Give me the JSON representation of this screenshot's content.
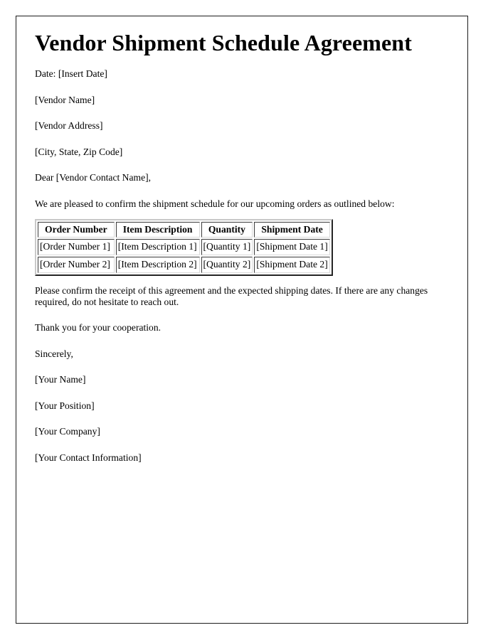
{
  "document": {
    "title": "Vendor Shipment Schedule Agreement",
    "date_line": "Date: [Insert Date]",
    "recipient": {
      "vendor_name": "[Vendor Name]",
      "vendor_address": "[Vendor Address]",
      "vendor_city_state_zip": "[City, State, Zip Code]"
    },
    "salutation": "Dear [Vendor Contact Name],",
    "intro_paragraph": "We are pleased to confirm the shipment schedule for our upcoming orders as outlined below:",
    "table": {
      "headers": [
        "Order Number",
        "Item Description",
        "Quantity",
        "Shipment Date"
      ],
      "rows": [
        [
          "[Order Number 1]",
          "[Item Description 1]",
          "[Quantity 1]",
          "[Shipment Date 1]"
        ],
        [
          "[Order Number 2]",
          "[Item Description 2]",
          "[Quantity 2]",
          "[Shipment Date 2]"
        ]
      ]
    },
    "confirm_paragraph": "Please confirm the receipt of this agreement and the expected shipping dates. If there are any changes required, do not hesitate to reach out.",
    "thanks_paragraph": "Thank you for your cooperation.",
    "closing": "Sincerely,",
    "signature": {
      "your_name": "[Your Name]",
      "your_position": "[Your Position]",
      "your_company": "[Your Company]",
      "your_contact": "[Your Contact Information]"
    }
  },
  "colors": {
    "page_border": "#1c1c1c",
    "text": "#000000",
    "table_border": "#9a9a9a",
    "background": "#ffffff"
  }
}
